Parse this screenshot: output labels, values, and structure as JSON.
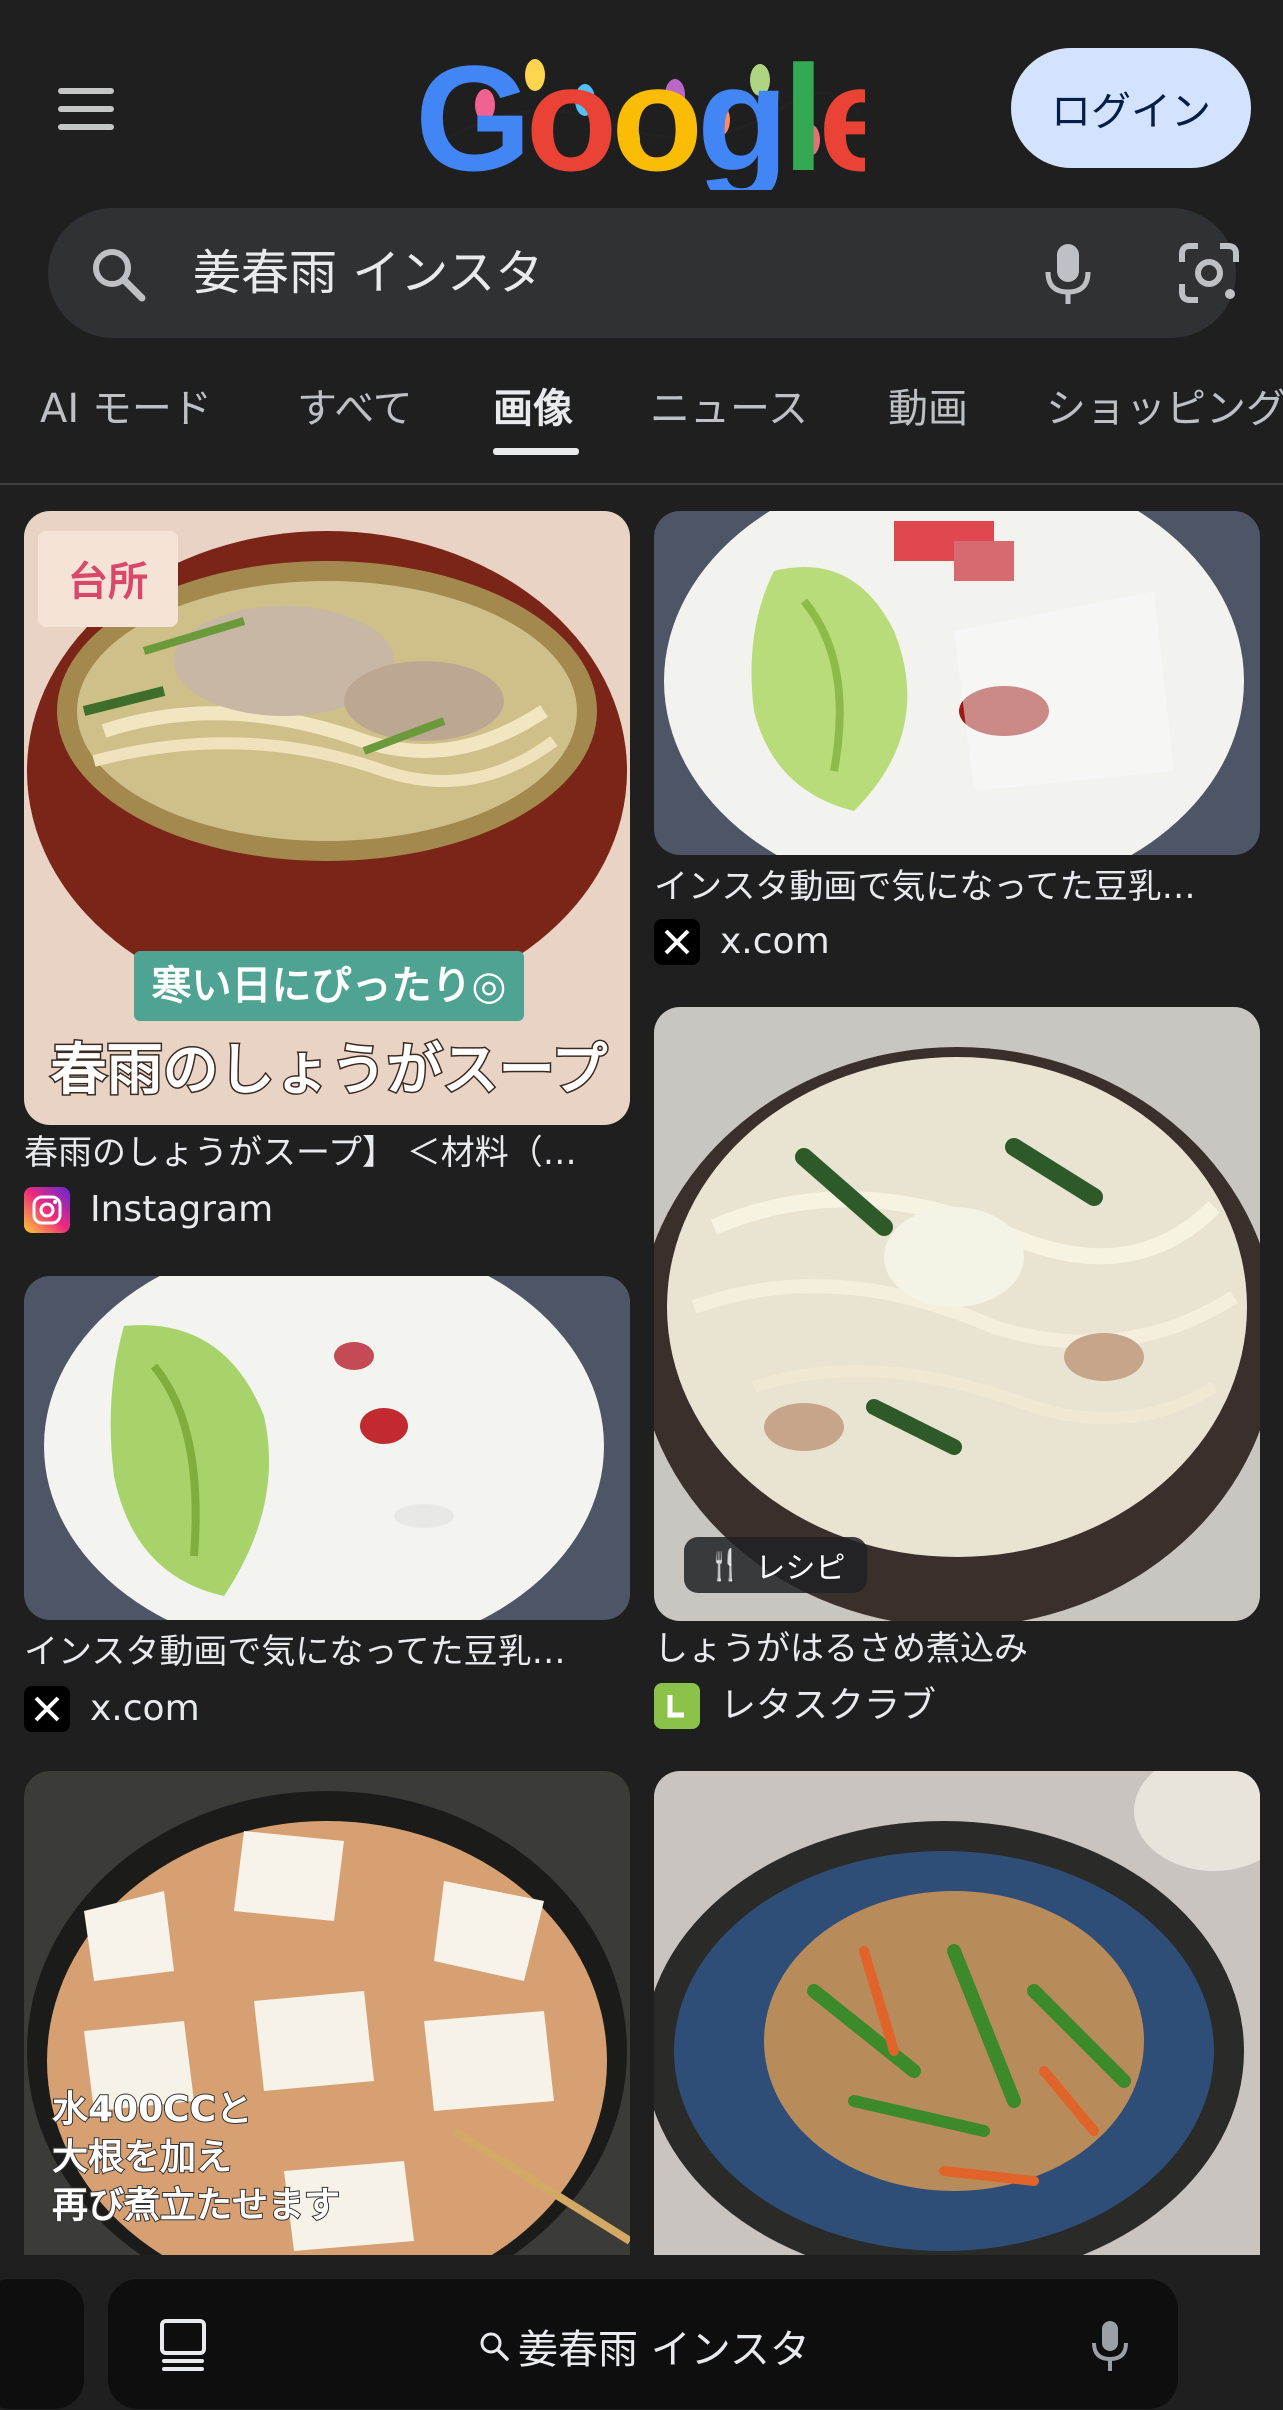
{
  "header": {
    "logo_text": "Google",
    "login_label": "ログイン"
  },
  "search": {
    "query": "姜春雨 インスタ"
  },
  "tabs": [
    {
      "label": "AI モード"
    },
    {
      "label": "すべて"
    },
    {
      "label": "画像"
    },
    {
      "label": "ニュース"
    },
    {
      "label": "動画"
    },
    {
      "label": "ショッピング"
    }
  ],
  "active_tab": "画像",
  "results": [
    {
      "title": "春雨のしょうがスープ】 ＜材料（…",
      "source": "Instagram",
      "overlay_caption": "寒い日にぴったり◎",
      "overlay_title": "春雨のしょうがスープ",
      "logo_text": "台所"
    },
    {
      "title": "インスタ動画で気になってた豆乳…",
      "source": "x.com"
    },
    {
      "title": "インスタ動画で気になってた豆乳…",
      "source": "x.com"
    },
    {
      "title": "しょうがはるさめ煮込み",
      "source": "レタスクラブ",
      "badge": "レシピ"
    },
    {
      "overlay_text": [
        "水400CCと",
        "大根を加え",
        "再び煮立たせます"
      ]
    },
    {}
  ],
  "bottom_bar": {
    "query": "姜春雨 インスタ"
  },
  "colors": {
    "background": "#1f1f1f",
    "search_bar": "#303134",
    "login_button": "#d3e3fd"
  }
}
